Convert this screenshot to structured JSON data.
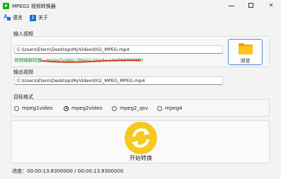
{
  "window": {
    "title": "MPEG2 视频转换器",
    "icon": "play-icon",
    "controls": [
      "minimize",
      "maximize",
      "close"
    ]
  },
  "menu": {
    "language": {
      "label": "语言",
      "icon": "language-icon"
    },
    "about": {
      "label": "关于",
      "icon": "info-icon"
    }
  },
  "input": {
    "section_label": "输入视频",
    "path": "C:\\Users\\Etern\\Desktop\\MyVideo\\002_MPEG.mp4",
    "codec_label": "视频编解码器：",
    "codec_value": "mpeg2video (Main) (mp4v / 0x7634706D)",
    "codec_color": "#2e8b2e",
    "underline_color": "#e03a1a"
  },
  "browse": {
    "label": "浏览",
    "icon": "folder-icon",
    "color": "#f0a400"
  },
  "output": {
    "section_label": "输出视频",
    "path": "C:\\Users\\Etern\\Desktop\\MyVideo\\002_MPEG_MPEG.mp4"
  },
  "format": {
    "section_label": "目标格式",
    "options": [
      {
        "label": "mpeg1video",
        "checked": false
      },
      {
        "label": "mpeg2video",
        "checked": true
      },
      {
        "label": "mpeg2_qsv",
        "checked": false
      },
      {
        "label": "mpeg4",
        "checked": false
      }
    ]
  },
  "convert": {
    "label": "开始转换",
    "icon": "convert-arrows-icon",
    "color": "#f7c81e"
  },
  "progress": {
    "text": "进度：00:00:13.8300000 / 00:00:13.8300000"
  }
}
